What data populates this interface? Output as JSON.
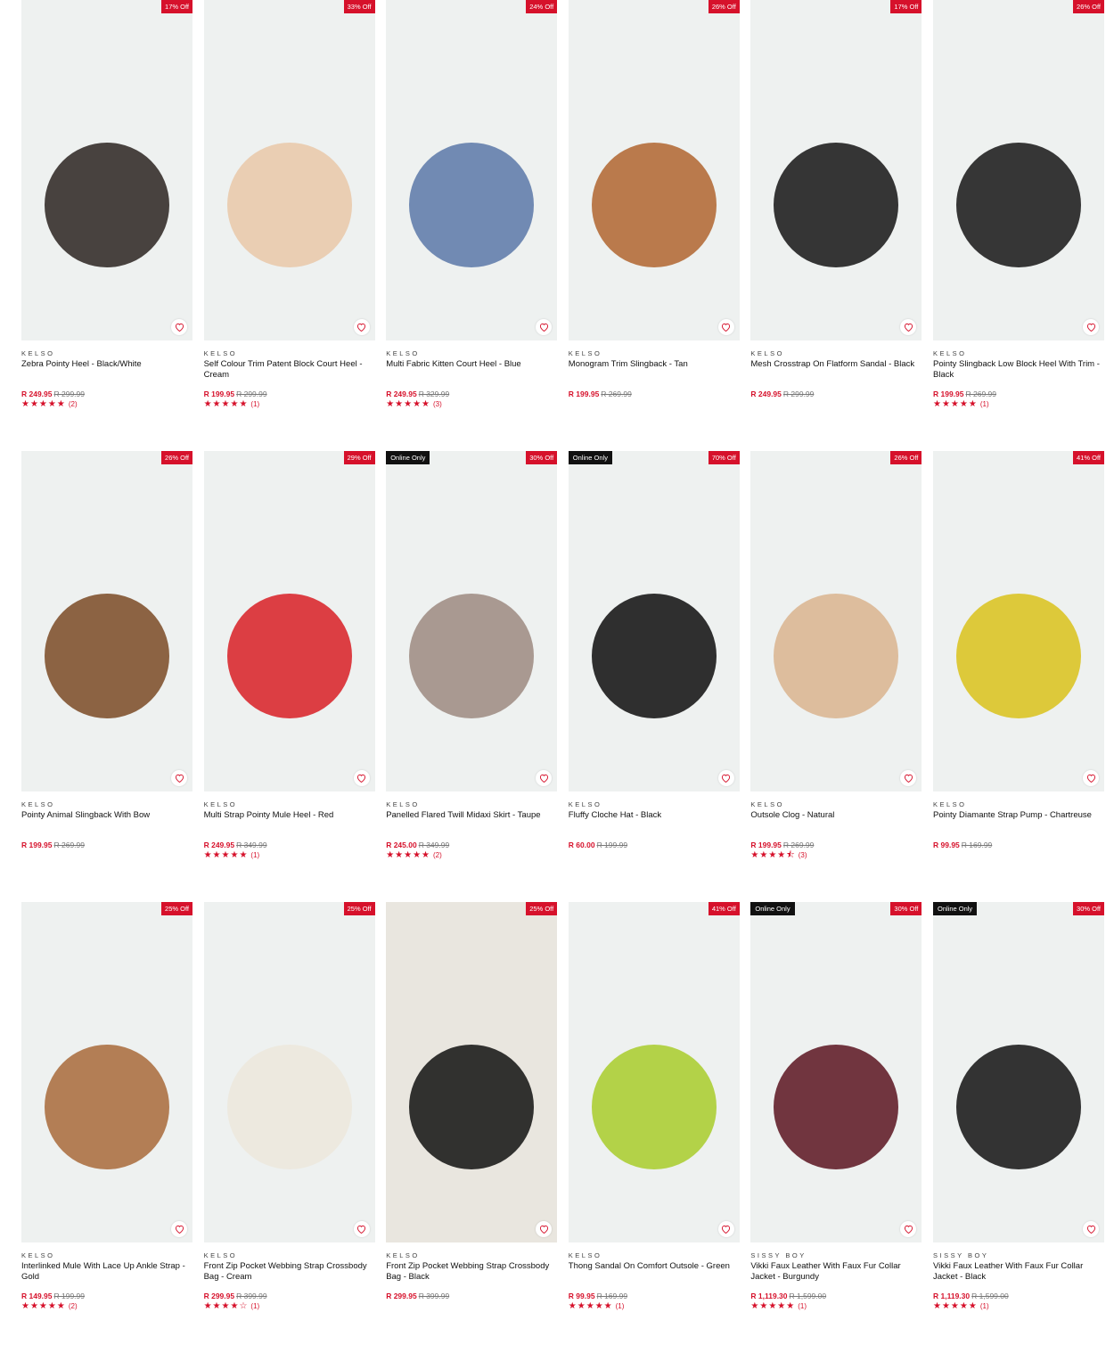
{
  "icons": {
    "wishlist": "heart-icon",
    "rating": "star-icon"
  },
  "colors": {
    "discount_badge": "#d6112b",
    "online_badge": "#111111",
    "price": "#d6112b",
    "stars": "#d6112b"
  },
  "products": [
    {
      "brand": "KELSO",
      "name": "Zebra Pointy Heel - Black/White",
      "price": "R 249.95",
      "was": "R 299.99",
      "discount": "17% Off",
      "online": "",
      "stars": "★★★★★",
      "reviews": "(2)",
      "bg": "#eef1f0",
      "item": "#2a2320"
    },
    {
      "brand": "KELSO",
      "name": "Self Colour Trim Patent Block Court Heel - Cream",
      "price": "R 199.95",
      "was": "R 299.99",
      "discount": "33% Off",
      "online": "",
      "stars": "★★★★★",
      "reviews": "(1)",
      "bg": "#eef1f0",
      "item": "#e9c8a8"
    },
    {
      "brand": "KELSO",
      "name": "Multi Fabric Kitten Court Heel - Blue",
      "price": "R 249.95",
      "was": "R 329.99",
      "discount": "24% Off",
      "online": "",
      "stars": "★★★★★",
      "reviews": "(3)",
      "bg": "#eef1f0",
      "item": "#5a78a8"
    },
    {
      "brand": "KELSO",
      "name": "Monogram Trim Slingback - Tan",
      "price": "R 199.95",
      "was": "R 269.99",
      "discount": "26% Off",
      "online": "",
      "stars": "",
      "reviews": "",
      "bg": "#eef1f0",
      "item": "#b0652f"
    },
    {
      "brand": "KELSO",
      "name": "Mesh Crosstrap On Flatform Sandal - Black",
      "price": "R 249.95",
      "was": "R 299.99",
      "discount": "17% Off",
      "online": "",
      "stars": "",
      "reviews": "",
      "bg": "#eef1f0",
      "item": "#141414"
    },
    {
      "brand": "KELSO",
      "name": "Pointy Slingback Low Block Heel With Trim - Black",
      "price": "R 199.95",
      "was": "R 269.99",
      "discount": "26% Off",
      "online": "",
      "stars": "★★★★★",
      "reviews": "(1)",
      "bg": "#eef1f0",
      "item": "#151515"
    },
    {
      "brand": "KELSO",
      "name": "Pointy Animal Slingback With Bow",
      "price": "R 199.95",
      "was": "R 269.99",
      "discount": "26% Off",
      "online": "",
      "stars": "",
      "reviews": "",
      "bg": "#eef1f0",
      "item": "#7a4a25"
    },
    {
      "brand": "KELSO",
      "name": "Multi Strap Pointy Mule Heel - Red",
      "price": "R 249.95",
      "was": "R 349.99",
      "discount": "29% Off",
      "online": "",
      "stars": "★★★★★",
      "reviews": "(1)",
      "bg": "#eef1f0",
      "item": "#d81e24"
    },
    {
      "brand": "KELSO",
      "name": "Panelled Flared Twill Midaxi Skirt - Taupe",
      "price": "R 245.00",
      "was": "R 349.99",
      "discount": "30% Off",
      "online": "Online Only",
      "stars": "★★★★★",
      "reviews": "(2)",
      "bg": "#eef1f0",
      "item": "#9c8a80"
    },
    {
      "brand": "KELSO",
      "name": "Fluffy Cloche Hat - Black",
      "price": "R 60.00",
      "was": "R 199.99",
      "discount": "70% Off",
      "online": "Online Only",
      "stars": "",
      "reviews": "",
      "bg": "#eef1f0",
      "item": "#0d0d0d"
    },
    {
      "brand": "KELSO",
      "name": "Outsole Clog - Natural",
      "price": "R 199.95",
      "was": "R 269.99",
      "discount": "26% Off",
      "online": "",
      "stars": "★★★★⯪",
      "reviews": "(3)",
      "bg": "#eef1f0",
      "item": "#d9b48e"
    },
    {
      "brand": "KELSO",
      "name": "Pointy Diamante Strap Pump - Chartreuse",
      "price": "R 99.95",
      "was": "R 169.99",
      "discount": "41% Off",
      "online": "",
      "stars": "",
      "reviews": "",
      "bg": "#eef1f0",
      "item": "#d9c21a"
    },
    {
      "brand": "KELSO",
      "name": "Interlinked Mule With Lace Up Ankle Strap - Gold",
      "price": "R 149.95",
      "was": "R 199.99",
      "discount": "25% Off",
      "online": "",
      "stars": "★★★★★",
      "reviews": "(2)",
      "bg": "#eef1f0",
      "item": "#a86a3a"
    },
    {
      "brand": "KELSO",
      "name": "Front Zip Pocket Webbing Strap Crossbody Bag - Cream",
      "price": "R 299.95",
      "was": "R 399.99",
      "discount": "25% Off",
      "online": "",
      "stars": "★★★★☆",
      "reviews": "(1)",
      "bg": "#eef1f0",
      "item": "#ece8dc"
    },
    {
      "brand": "KELSO",
      "name": "Front Zip Pocket Webbing Strap Crossbody Bag - Black",
      "price": "R 299.95",
      "was": "R 399.99",
      "discount": "25% Off",
      "online": "",
      "stars": "",
      "reviews": "",
      "bg": "#e9e6df",
      "item": "#111111"
    },
    {
      "brand": "KELSO",
      "name": "Thong Sandal On Comfort Outsole - Green",
      "price": "R 99.95",
      "was": "R 169.99",
      "discount": "41% Off",
      "online": "",
      "stars": "★★★★★",
      "reviews": "(1)",
      "bg": "#eef1f0",
      "item": "#a8cc2a"
    },
    {
      "brand": "SISSY BOY",
      "name": "Vikki Faux Leather With Faux Fur Collar Jacket - Burgundy",
      "price": "R 1,119.30",
      "was": "R 1,599.00",
      "discount": "30% Off",
      "online": "Online Only",
      "stars": "★★★★★",
      "reviews": "(1)",
      "bg": "#eef1f0",
      "item": "#5a1420"
    },
    {
      "brand": "SISSY BOY",
      "name": "Vikki Faux Leather With Faux Fur Collar Jacket - Black",
      "price": "R 1,119.30",
      "was": "R 1,599.00",
      "discount": "30% Off",
      "online": "Online Only",
      "stars": "★★★★★",
      "reviews": "(1)",
      "bg": "#eef1f0",
      "item": "#121212"
    }
  ]
}
